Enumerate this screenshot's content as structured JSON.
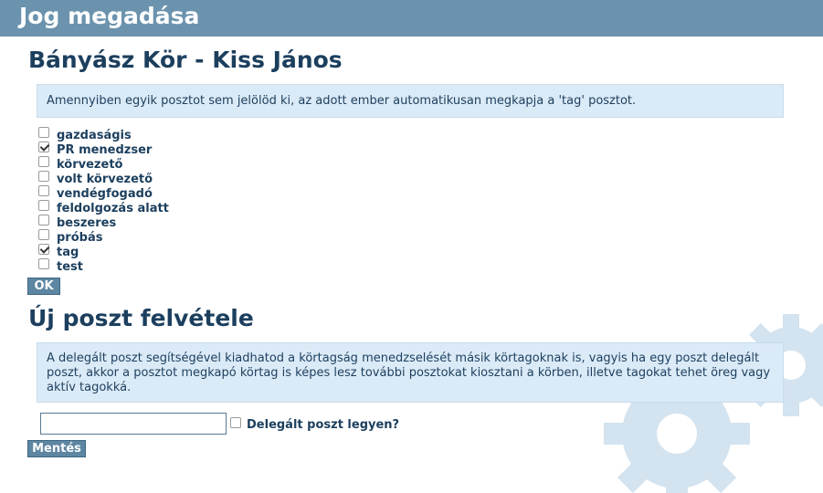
{
  "page": {
    "title": "Jog megadása",
    "member_heading": "Bányász Kör - Kiss János",
    "posts_info": "Amennyiben egyik posztot sem jelölöd ki, az adott ember automatikusan megkapja a 'tag' posztot.",
    "posts": [
      {
        "label": "gazdaságis",
        "checked": false
      },
      {
        "label": "PR menedzser",
        "checked": true
      },
      {
        "label": "körvezető",
        "checked": false
      },
      {
        "label": "volt körvezető",
        "checked": false
      },
      {
        "label": "vendégfogadó",
        "checked": false
      },
      {
        "label": "feldolgozás alatt",
        "checked": false
      },
      {
        "label": "beszeres",
        "checked": false
      },
      {
        "label": "próbás",
        "checked": false
      },
      {
        "label": "tag",
        "checked": true
      },
      {
        "label": "test",
        "checked": false
      }
    ],
    "ok_label": "OK",
    "new_post_heading": "Új poszt felvétele",
    "new_post_info": "A delegált poszt segítségével kiadhatod a körtagság menedzselését másik körtagoknak is, vagyis ha egy poszt delegált poszt, akkor a posztot megkapó körtag is képes lesz további posztokat kiosztani a körben, illetve tagokat tehet öreg vagy aktív tagokká.",
    "new_post_name_value": "",
    "delegated_checked": false,
    "delegated_label": "Delegált poszt legyen?",
    "save_label": "Mentés"
  },
  "colors": {
    "header_bg": "#6b93ae",
    "heading_text": "#1c3f5e",
    "info_bg": "#dbeaf7",
    "button_bg": "#5d86a2",
    "gear": "#d3e3ef"
  },
  "icons": {
    "background_decoration": "gears-icon"
  }
}
